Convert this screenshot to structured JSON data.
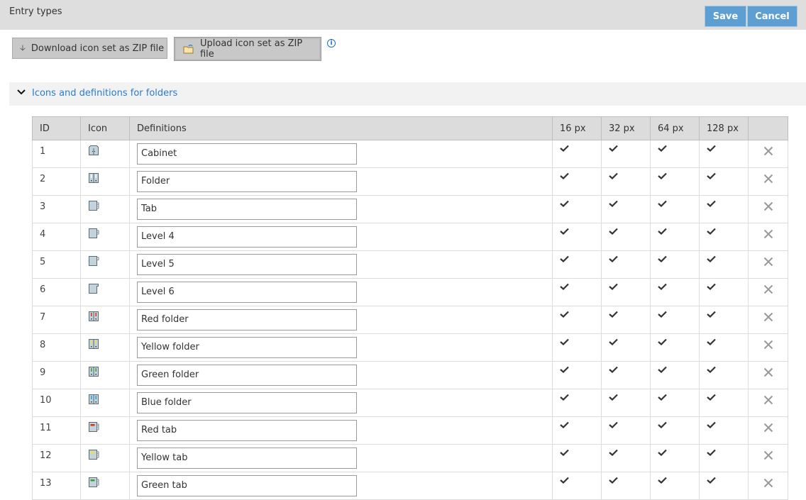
{
  "header": {
    "title": "Entry types",
    "save_label": "Save",
    "cancel_label": "Cancel"
  },
  "toolbar": {
    "download_label": "Download icon set as ZIP file",
    "upload_label": "Upload icon set as ZIP file",
    "info_icon": "info-icon"
  },
  "section": {
    "label": "Icons and definitions for folders",
    "expanded": true
  },
  "table": {
    "columns": [
      "ID",
      "Icon",
      "Definitions",
      "16 px",
      "32 px",
      "64 px",
      "128 px",
      ""
    ],
    "rows": [
      {
        "id": "1",
        "icon": "cabinet",
        "color": "",
        "definition": "Cabinet"
      },
      {
        "id": "2",
        "icon": "folder",
        "color": "",
        "definition": "Folder"
      },
      {
        "id": "3",
        "icon": "tab",
        "color": "",
        "definition": "Tab"
      },
      {
        "id": "4",
        "icon": "level4",
        "color": "",
        "definition": "Level 4"
      },
      {
        "id": "5",
        "icon": "level5",
        "color": "",
        "definition": "Level 5"
      },
      {
        "id": "6",
        "icon": "level6",
        "color": "",
        "definition": "Level 6"
      },
      {
        "id": "7",
        "icon": "folder",
        "color": "#d0321e",
        "definition": "Red folder"
      },
      {
        "id": "8",
        "icon": "folder",
        "color": "#f0e040",
        "definition": "Yellow folder"
      },
      {
        "id": "9",
        "icon": "folder",
        "color": "#3c9a3c",
        "definition": "Green folder"
      },
      {
        "id": "10",
        "icon": "folder",
        "color": "#2a9ad8",
        "definition": "Blue folder"
      },
      {
        "id": "11",
        "icon": "tab",
        "color": "#d0321e",
        "definition": "Red tab"
      },
      {
        "id": "12",
        "icon": "tab",
        "color": "#f0e040",
        "definition": "Yellow tab"
      },
      {
        "id": "13",
        "icon": "tab",
        "color": "#3c9a3c",
        "definition": "Green tab"
      }
    ]
  },
  "colors": {
    "accent": "#5d9fd3",
    "link": "#2a7cd0"
  }
}
